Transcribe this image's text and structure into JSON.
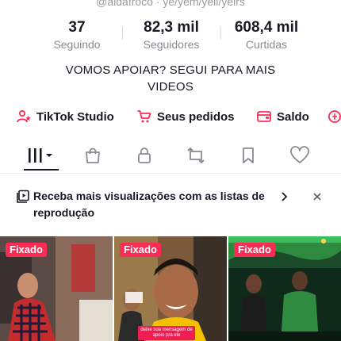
{
  "profile": {
    "handle": "@aldafroco · ye/yem/yell/yelrs"
  },
  "stats": [
    {
      "value": "37",
      "label": "Seguindo"
    },
    {
      "value": "82,3 mil",
      "label": "Seguidores"
    },
    {
      "value": "608,4 mil",
      "label": "Curtidas"
    }
  ],
  "bio": {
    "line1": "VOMOS APOIAR? SEGUI PARA MAIS",
    "line2": "VIDEOS"
  },
  "links": [
    {
      "label": "TikTok Studio",
      "icon": "person-star-icon"
    },
    {
      "label": "Seus pedidos",
      "icon": "cart-icon"
    },
    {
      "label": "Saldo",
      "icon": "wallet-icon"
    }
  ],
  "tabs": [
    {
      "name": "grid-icon",
      "active": true
    },
    {
      "name": "shopping-bag-icon"
    },
    {
      "name": "lock-icon"
    },
    {
      "name": "repost-icon"
    },
    {
      "name": "bookmark-icon"
    },
    {
      "name": "heart-icon"
    }
  ],
  "promo": {
    "text": "Receba mais visualizações com as listas de reprodução",
    "icon": "playlist-icon"
  },
  "videos": [
    {
      "badge": "Fixado"
    },
    {
      "badge": "Fixado",
      "caption": "deixe sua mensagem de apoio pra ele"
    },
    {
      "badge": "Fixado"
    }
  ],
  "colors": {
    "accent": "#fe2c55",
    "text": "#161823",
    "muted": "#8a8b91"
  }
}
